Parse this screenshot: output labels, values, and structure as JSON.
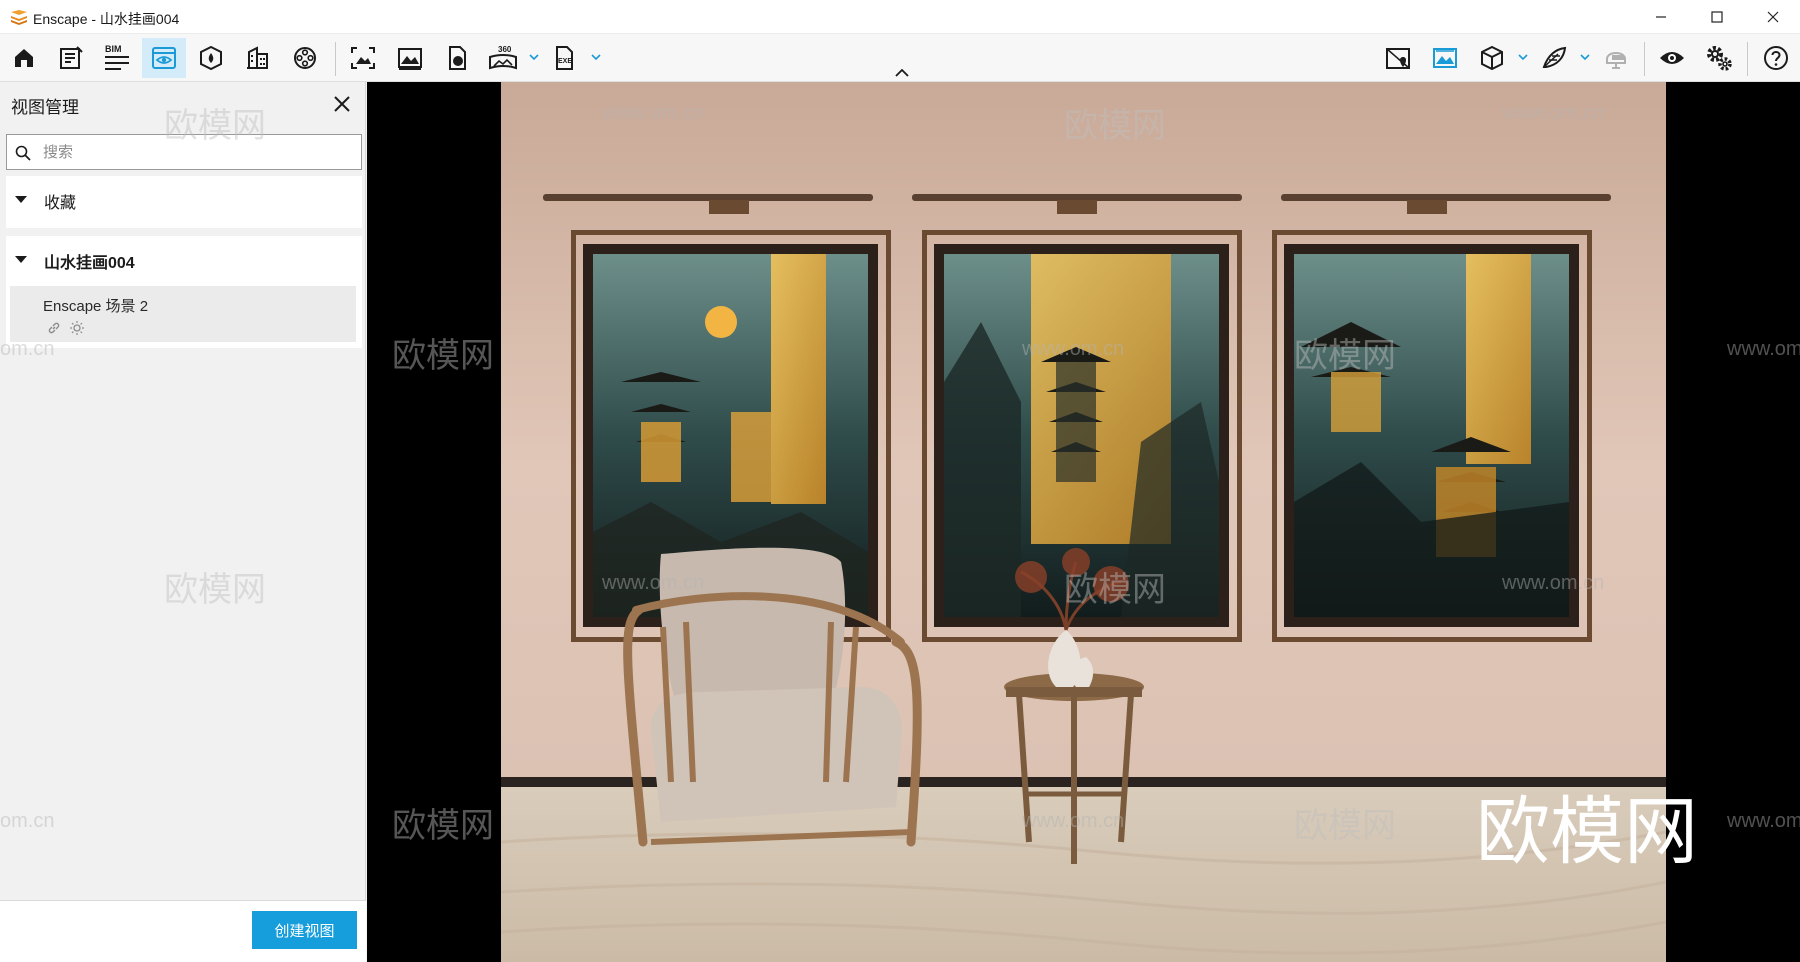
{
  "window": {
    "title": "Enscape - 山水挂画004",
    "logo_icon": "enscape-logo-icon",
    "controls": [
      "minimize-icon",
      "maximize-icon",
      "close-icon"
    ]
  },
  "toolbar": {
    "bim_label": "BIM",
    "panorama_label": "360",
    "exe_label": "EXE",
    "accent_color": "#1a9ad6",
    "active_color": "#d4ecf9"
  },
  "panel": {
    "title": "视图管理",
    "search_placeholder": "搜索",
    "groups": [
      {
        "label": "收藏",
        "expanded": true,
        "bold": false
      },
      {
        "label": "山水挂画004",
        "expanded": true,
        "bold": true,
        "items": [
          {
            "name": "Enscape 场景 2",
            "icons": [
              "link-icon",
              "sun-icon"
            ]
          }
        ]
      }
    ],
    "create_button": "创建视图",
    "button_color": "#159ddc"
  },
  "viewport": {
    "watermark_small": "www.om.cn",
    "watermark_cn": "欧模网",
    "watermark_big": "欧模网",
    "watermark_partial": "om.cn"
  }
}
